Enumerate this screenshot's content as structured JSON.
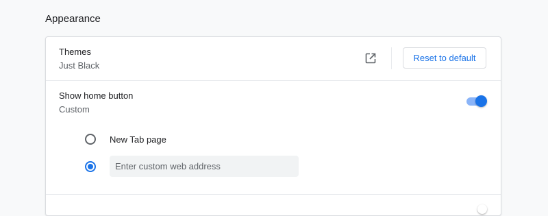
{
  "section": {
    "title": "Appearance"
  },
  "themes": {
    "label": "Themes",
    "value": "Just Black",
    "open_icon": "open-in-new-icon",
    "reset_label": "Reset to default"
  },
  "home_button": {
    "label": "Show home button",
    "value": "Custom",
    "enabled": true,
    "options": [
      {
        "label": "New Tab page",
        "selected": false
      },
      {
        "placeholder": "Enter custom web address",
        "value": "",
        "selected": true
      }
    ]
  },
  "colors": {
    "accent": "#1a73e8",
    "toggle_track": "#8ab4f8",
    "background": "#f8f9fa"
  }
}
